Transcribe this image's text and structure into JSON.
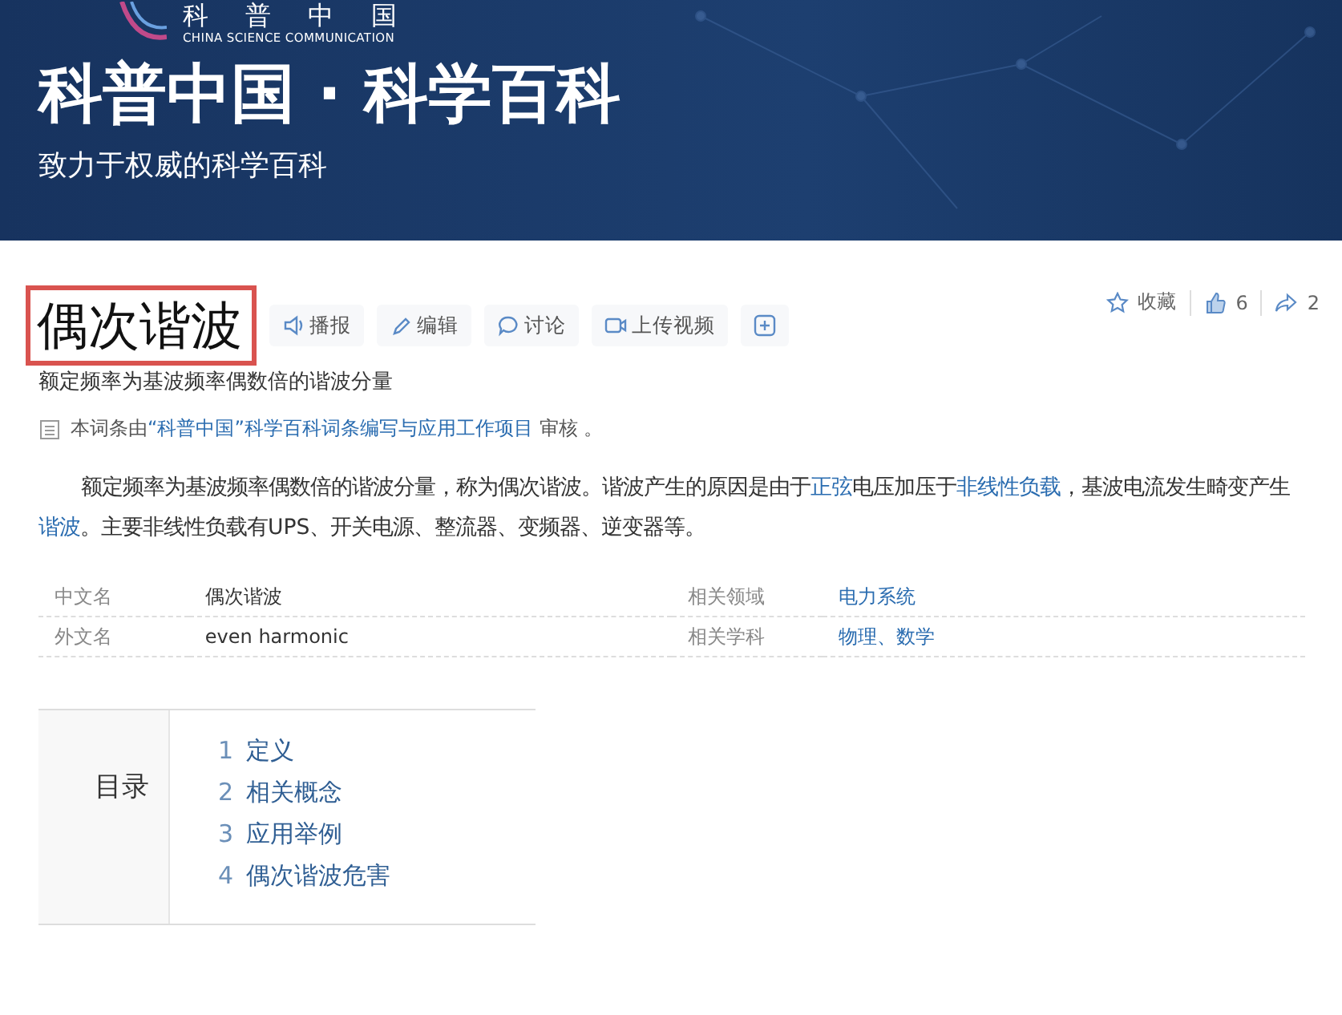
{
  "banner": {
    "logo_cn": "科 普 中 国",
    "logo_en": "CHINA SCIENCE COMMUNICATION",
    "title": "科普中国 · 科学百科",
    "subtitle": "致力于权威的科学百科"
  },
  "entry": {
    "title": "偶次谐波",
    "title_highlighted": true,
    "actions": [
      {
        "kind": "speaker",
        "label": "播报"
      },
      {
        "kind": "pencil",
        "label": "编辑"
      },
      {
        "kind": "bubble",
        "label": "讨论"
      },
      {
        "kind": "video",
        "label": "上传视频"
      },
      {
        "kind": "plus"
      }
    ],
    "stats": [
      {
        "kind": "star",
        "label": "收藏"
      },
      {
        "kind": "thumb",
        "label": "6"
      },
      {
        "kind": "share",
        "label": "2"
      }
    ],
    "summary": "额定频率为基波频率偶数倍的谐波分量",
    "review": [
      {
        "text": "本词条由",
        "link": false
      },
      {
        "text": "“科普中国”科学百科词条编写与应用工作项目",
        "link": true
      },
      {
        "text": " 审核 。",
        "link": false
      }
    ],
    "paragraph": [
      {
        "text": "额定频率为基波频率偶数倍的谐波分量，称为偶次谐波。谐波产生的原因是由于",
        "link": false
      },
      {
        "text": "正弦",
        "link": true
      },
      {
        "text": "电压加压于",
        "link": false
      },
      {
        "text": "非线性负载",
        "link": true
      },
      {
        "text": "，基波电流发生畸变产生",
        "link": false
      },
      {
        "text": "谐波",
        "link": true
      },
      {
        "text": "。主要非线性负载有UPS、开关电源、整流器、变频器、逆变器等。",
        "link": false
      }
    ],
    "infobox": [
      [
        {
          "name": "中文名",
          "value": "偶次谐波",
          "link": false
        },
        {
          "name": "相关领域",
          "value": "电力系统",
          "link": true
        }
      ],
      [
        {
          "name": "外文名",
          "value": "even harmonic",
          "link": false
        },
        {
          "name": "相关学科",
          "value": "物理、数学",
          "link": true
        }
      ]
    ],
    "toc": {
      "heading": "目录",
      "items": [
        {
          "number": "1",
          "label": "定义"
        },
        {
          "number": "2",
          "label": "相关概念"
        },
        {
          "number": "3",
          "label": "应用举例"
        },
        {
          "number": "4",
          "label": "偶次谐波危害"
        }
      ]
    }
  }
}
